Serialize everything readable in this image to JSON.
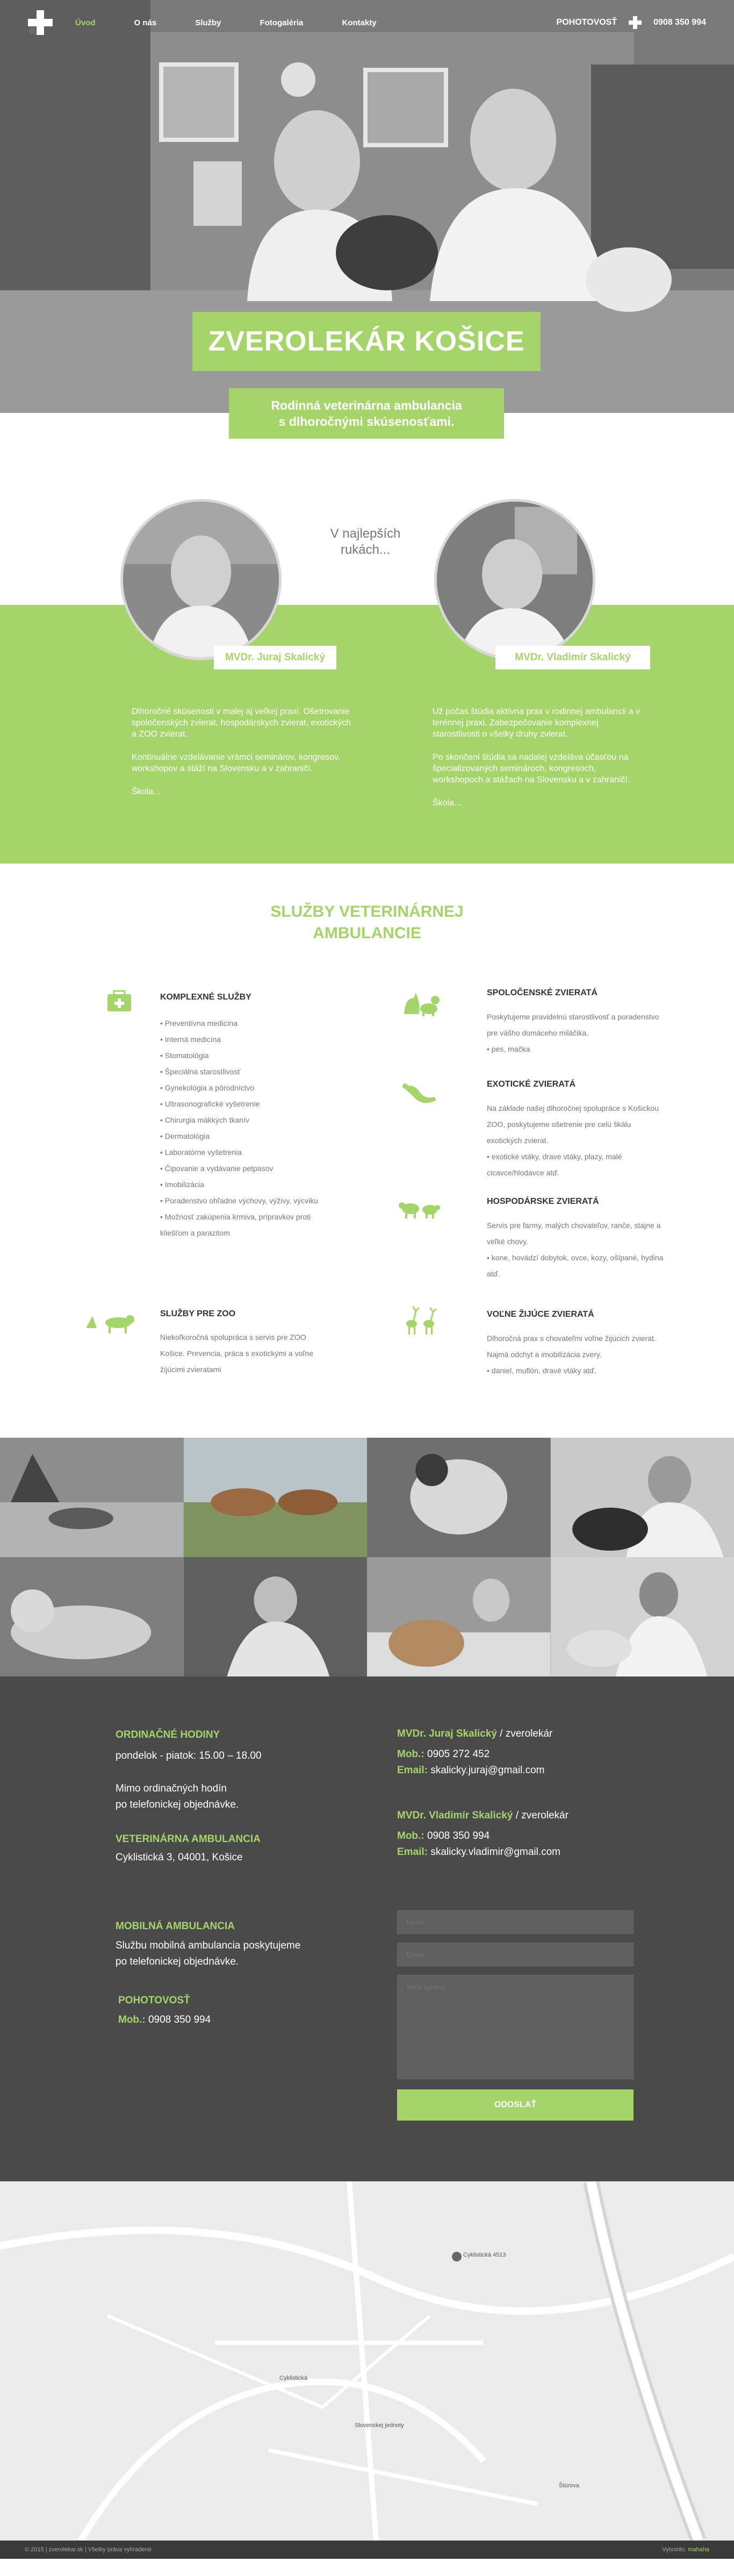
{
  "nav": {
    "items": [
      {
        "label": "Úvod",
        "active": true
      },
      {
        "label": "O nás",
        "active": false
      },
      {
        "label": "Služby",
        "active": false
      },
      {
        "label": "Fotogaléria",
        "active": false
      },
      {
        "label": "Kontakty",
        "active": false
      }
    ],
    "emergency_label": "POHOTOVOSŤ",
    "phone": "0908 350 994"
  },
  "hero": {
    "title": "ZVEROLEKÁR KOŠICE",
    "subtitle_line1": "Rodinná veterinárna ambulancia",
    "subtitle_line2": "s dlhoročnými skúsenosťami."
  },
  "doctors": {
    "tagline_line1": "V najlepších",
    "tagline_line2": "rukách...",
    "left": {
      "name": "MVDr. Juraj Skalický",
      "p1": "Dlhoročné skúsenosti v malej aj veľkej praxi. Ošetrovanie spoločenských zvierat, hospodárskych zvierat, exotických a ZOO zvierat.",
      "p2": "Kontinuálne vzdelávanie vrámci seminárov, kongresov, workshopov a stáží na Slovensku a v zahraničí.",
      "more": "Škola..."
    },
    "right": {
      "name": "MVDr. Vladimír Skalický",
      "p1": "Už počas štúdia aktívna prax v rodinnej ambulancii a v terénnej praxi. Zabezpečovanie komplexnej starostlivosti o všetky druhy zvierat.",
      "p2": "Po skončení štúdia sa nadalej vzdeláva účasťou na špecializovaných seminároch, kongresoch, workshopoch a stážach na Slovensku a v zahraničí.",
      "more": "Škola..."
    }
  },
  "services": {
    "title_line1": "SLUŽBY VETERINÁRNEJ",
    "title_line2": "AMBULANCIE",
    "complex": {
      "title": "KOMPLEXNÉ SLUŽBY",
      "items": [
        "Preventívna medicína",
        "Interná medicína",
        "Stomatológia",
        "Špeciálna starostlivosť",
        "Gynekológia a pôrodníctvo",
        "Ultrasonografické vyšetrenie",
        "Chirurgia mäkkých tkanív",
        "Dermatológia",
        "Laboratórne vyšetrenia",
        "Čipovanie a vydávanie petpasov",
        "Imobilizácia",
        "Poradenstvo ohľadne výchovy, výživy, výcviku",
        "Možnosť zakúpenia krmiva, prípravkov proti kliešťom a parazitom"
      ]
    },
    "zoo": {
      "title": "SLUŽBY PRE ZOO",
      "body": "Niekoľkoročná spolupráca s servis pre ZOO Košice. Prevencia, práca s exotickými a voľne žijúcimi zvieratami"
    },
    "pets": {
      "title": "SPOLOČENSKÉ ZVIERATÁ",
      "body": "Poskytujeme pravidelnú starostlivosť a poradenstvo pre vášho domáceho miláčika.",
      "items": [
        "pes, mačka"
      ]
    },
    "exotic": {
      "title": "EXOTICKÉ ZVIERATÁ",
      "body": "Na základe našej dlhoročnej spolupráce s Košickou ZOO, poskytujeme ošetrenie pre celú škálu exotických zvierat.",
      "items": [
        "exotické vtáky, drave vtáky, plazy, malé cicavce/hlodavce atď."
      ]
    },
    "farm": {
      "title": "HOSPODÁRSKE ZVIERATÁ",
      "body": "Servis pre farmy, malých chovateľov, ranče, stajne a veľké chovy.",
      "items": [
        "kone, hovädzí dobytok, ovce, kozy, ošípané, hydina atď."
      ]
    },
    "wild": {
      "title": "VOĽNE ŽIJÚCE ZVIERATÁ",
      "body": "Dlhoročná prax s chovateľmi voľne žijúcich zvierat. Najmä odchyt a imobilizácia zvery.",
      "items": [
        "daniel, muflón, dravé vtáky atď."
      ]
    }
  },
  "contact": {
    "hours_title": "ORDINAČNÉ HODINY",
    "hours": "pondelok - piatok: 15.00 – 18.00",
    "outside_line1": "Mimo ordinačných hodín",
    "outside_line2": "po telefonickej objednávke.",
    "clinic_title": "VETERINÁRNA AMBULANCIA",
    "clinic_address": "Cyklistická 3, 04001, Košice",
    "mobile_title": "MOBILNÁ AMBULANCIA",
    "mobile_line1": "Službu mobilná ambulancia poskytujeme",
    "mobile_line2": "po telefonickej objednávke.",
    "emergency_title": "POHOTOVOSŤ",
    "emergency_mob_label": "Mob.:",
    "emergency_phone": "0908 350 994",
    "doc1_name": "MVDr. Juraj Skalický",
    "doc1_role": "/ zverolekár",
    "doc1_mob_label": "Mob.:",
    "doc1_phone": "0905 272 452",
    "doc1_email_label": "Email:",
    "doc1_email": "skalicky.juraj@gmail.com",
    "doc2_name": "MVDr. Vladimír Skalický",
    "doc2_role": "/ zverolekár",
    "doc2_mob_label": "Mob.:",
    "doc2_phone": "0908 350 994",
    "doc2_email_label": "Email:",
    "doc2_email": "skalicky.vladimir@gmail.com",
    "form": {
      "name_placeholder": "Meno",
      "email_placeholder": "Email",
      "message_placeholder": "Vaša správa...",
      "submit": "ODOSLAŤ"
    }
  },
  "map": {
    "pin_label": "Cyklistická 4513",
    "street1": "Cyklistická",
    "street2": "Slovenskej jednoty",
    "street3": "Štúrova"
  },
  "footer": {
    "left": "© 2015 | zverolekar.sk | Všetky práva vyhradené",
    "credit_label": "Vytvorilo:",
    "credit_name": "mahaha"
  },
  "colors": {
    "accent": "#a5d46a",
    "dark": "#4a4a4a"
  }
}
